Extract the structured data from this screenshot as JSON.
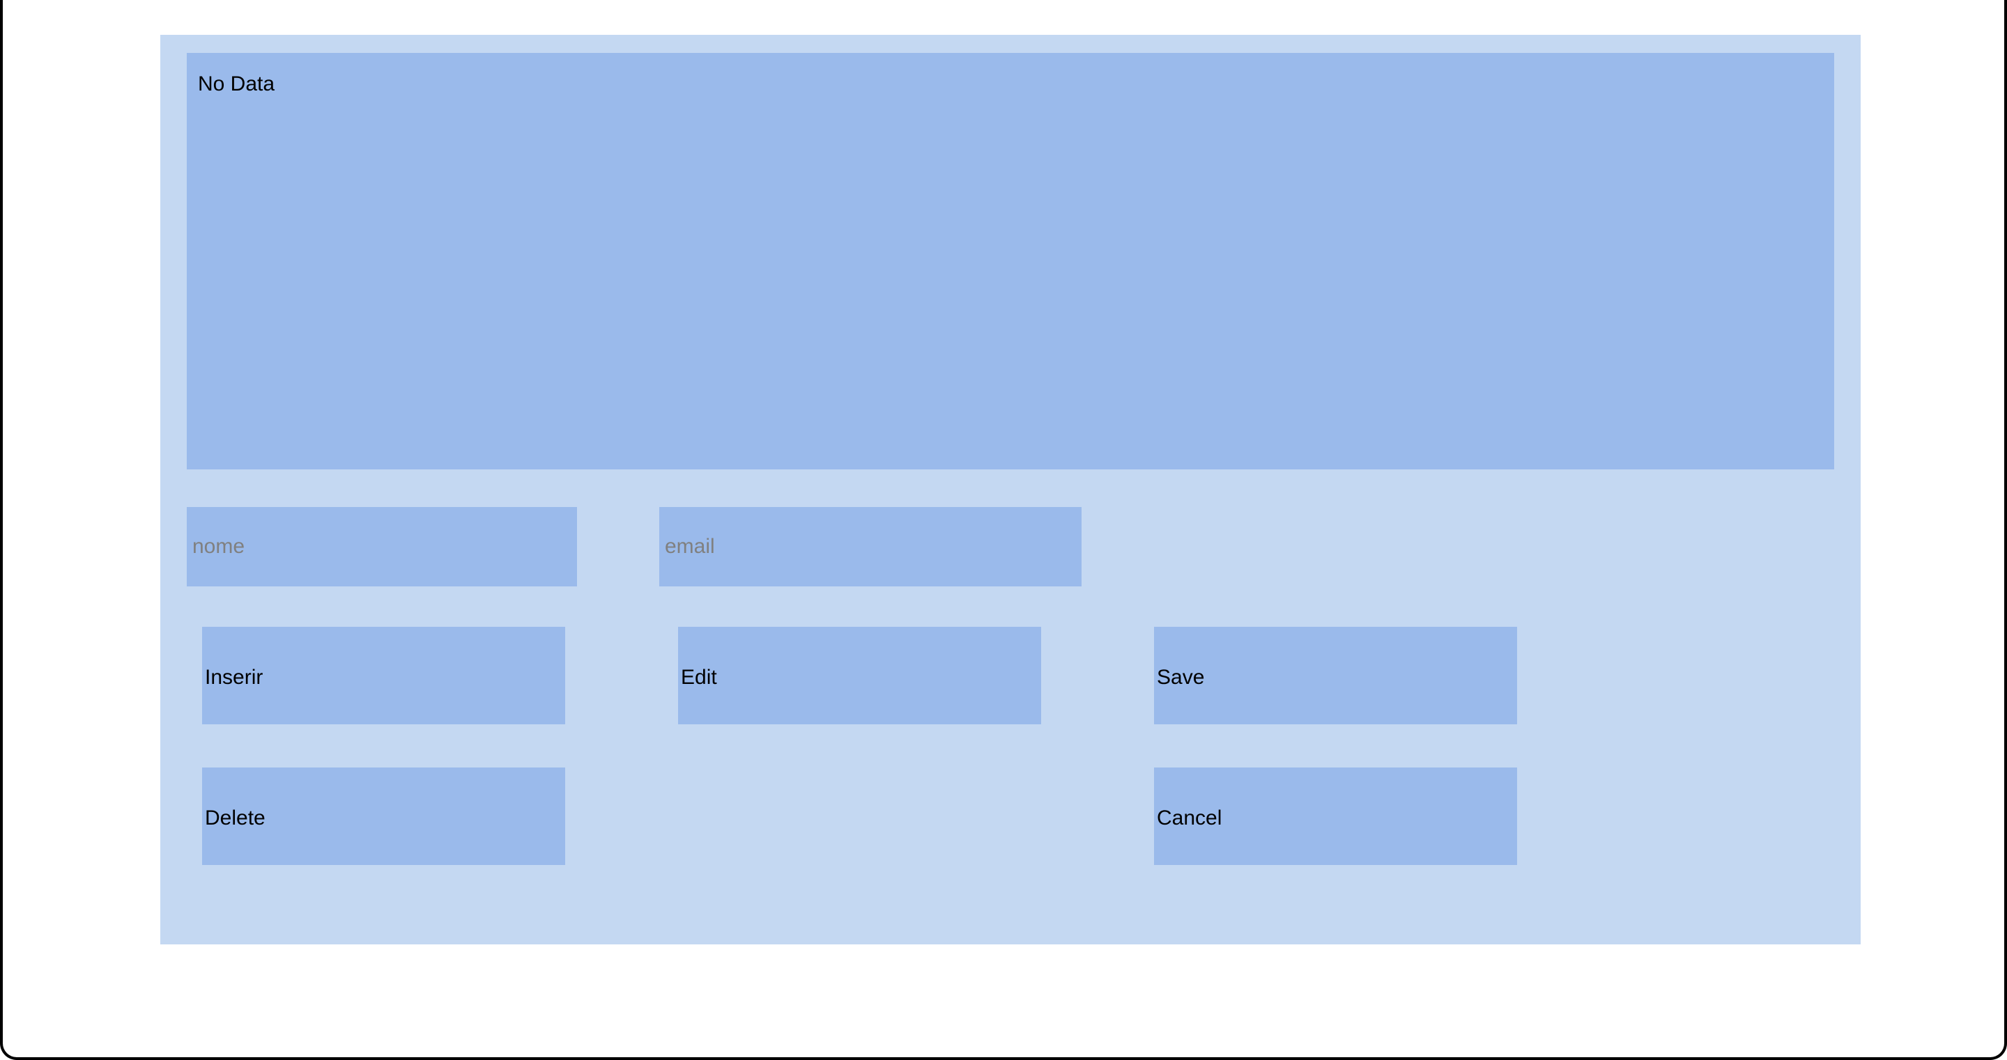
{
  "panel": {
    "empty_message": "No Data"
  },
  "inputs": {
    "name": {
      "placeholder": "nome",
      "value": ""
    },
    "email": {
      "placeholder": "email",
      "value": ""
    }
  },
  "buttons": {
    "insert": "Inserir",
    "edit": "Edit",
    "save": "Save",
    "delete": "Delete",
    "cancel": "Cancel"
  },
  "colors": {
    "container_bg": "#c4d8f2",
    "widget_bg": "#9abaeb",
    "placeholder": "#808080",
    "text": "#000000"
  }
}
